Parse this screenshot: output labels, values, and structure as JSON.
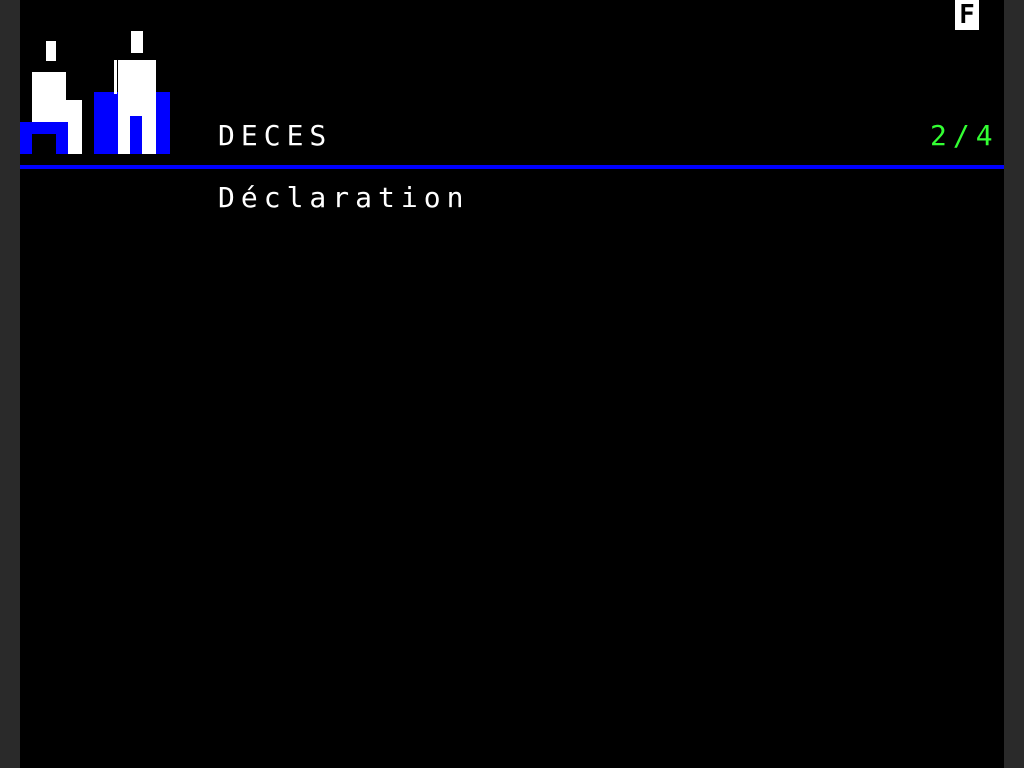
{
  "status_indicator": "F",
  "header": {
    "title": "DECES",
    "page_counter": "2/4"
  },
  "subtitle": "Déclaration",
  "colors": {
    "background": "#000000",
    "text": "#ffffff",
    "accent": "#0000ff",
    "counter": "#33ff33"
  },
  "logo_icon": "two-people-figures-icon"
}
